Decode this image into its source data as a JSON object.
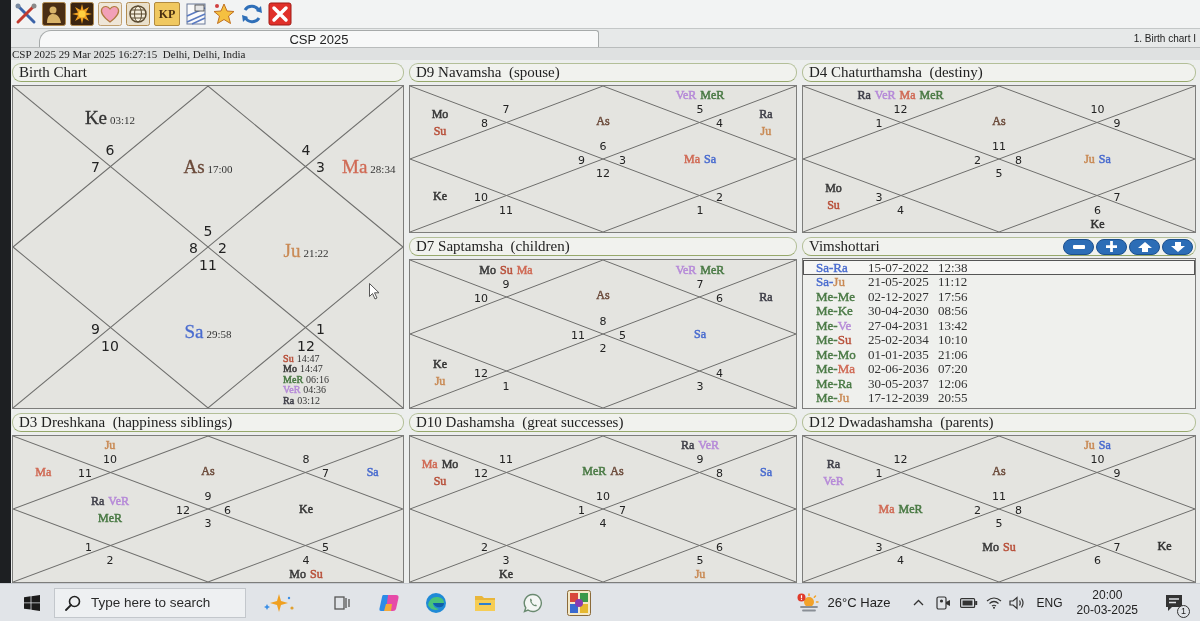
{
  "toolbar": [
    {
      "kind": "tools"
    },
    {
      "kind": "portrait"
    },
    {
      "kind": "sun"
    },
    {
      "kind": "heart"
    },
    {
      "kind": "globe"
    },
    {
      "kind": "text",
      "label": "KP"
    },
    {
      "kind": "document"
    },
    {
      "kind": "star"
    },
    {
      "kind": "refresh"
    },
    {
      "kind": "close"
    }
  ],
  "tabs": [
    {
      "label": "CSP 2025",
      "selected": true
    }
  ],
  "view_label": "1. Birth chart I",
  "info": "CSP 2025 29 Mar 2025 16:27:15  Delhi, Delhi, India",
  "panels": [
    {
      "kind": "rasi",
      "title": "Birth Chart",
      "mouse_pointer": true,
      "signs": [
        "6",
        "4",
        "7",
        "3",
        "5",
        "8",
        "2",
        "11",
        "9",
        "1",
        "10",
        "12"
      ],
      "placements": [
        {
          "kind": "top-left",
          "planets": [
            {
              "name": "Ke",
              "degree": "03:12",
              "color": "#333333"
            }
          ]
        },
        {
          "kind": "top",
          "planets": [
            {
              "name": "As",
              "degree": "17:00",
              "color": "#6b4a3a"
            }
          ]
        },
        {
          "kind": "right-upper",
          "planets": [
            {
              "name": "Ma",
              "degree": "28:34",
              "color": "#d06a55"
            }
          ]
        },
        {
          "kind": "right",
          "planets": [
            {
              "name": "Ju",
              "degree": "21:22",
              "color": "#c98a55"
            }
          ]
        },
        {
          "kind": "bottom",
          "planets": [
            {
              "name": "Sa",
              "degree": "29:58",
              "color": "#4a6ccf"
            }
          ]
        },
        {
          "kind": "bottom-right",
          "planets": [
            {
              "name": "Su",
              "degree": "14:47",
              "color": "#b8503a"
            },
            {
              "name": "Mo",
              "degree": "14:47",
              "color": "#3a3a3a"
            },
            {
              "name": "MeR",
              "degree": "06:16",
              "color": "#4a7a45"
            },
            {
              "name": "VeR",
              "degree": "04:36",
              "color": "#b68ad8"
            },
            {
              "name": "Ra",
              "degree": "03:12",
              "color": "#3e3e48"
            }
          ]
        }
      ]
    },
    {
      "kind": "varga",
      "title": "D9 Navamsha  (spouse)",
      "signs": [
        "7",
        "5",
        "8",
        "4",
        "6",
        "9",
        "3",
        "12",
        "10",
        "2",
        "11",
        "1"
      ],
      "placements": [
        {
          "kind": "top-right",
          "planets": [
            {
              "name": "VeR",
              "color": "#b68ad8"
            },
            {
              "name": "MeR",
              "color": "#4a7a45"
            }
          ]
        },
        {
          "kind": "left-upper",
          "planets": [
            {
              "name": "Mo",
              "color": "#3a3a3a"
            },
            {
              "name": "Su",
              "color": "#b8503a"
            }
          ]
        },
        {
          "kind": "top",
          "planets": [
            {
              "name": "As",
              "color": "#6b4a3a"
            }
          ]
        },
        {
          "kind": "right-upper",
          "planets": [
            {
              "name": "Ra",
              "color": "#3e3e48"
            },
            {
              "name": "Ju",
              "color": "#c98a55"
            }
          ]
        },
        {
          "kind": "right",
          "planets": [
            {
              "name": "Ma",
              "color": "#d06a55"
            },
            {
              "name": "Sa",
              "color": "#4a6ccf"
            }
          ]
        },
        {
          "kind": "left-lower",
          "planets": [
            {
              "name": "Ke",
              "color": "#333333"
            }
          ]
        }
      ]
    },
    {
      "kind": "varga",
      "title": "D4 Chaturthamsha  (destiny)",
      "signs": [
        "12",
        "10",
        "1",
        "9",
        "11",
        "2",
        "8",
        "5",
        "3",
        "7",
        "4",
        "6"
      ],
      "placements": [
        {
          "kind": "top-left",
          "planets": [
            {
              "name": "Ra",
              "color": "#3e3e48"
            },
            {
              "name": "VeR",
              "color": "#b68ad8"
            },
            {
              "name": "Ma",
              "color": "#d06a55"
            },
            {
              "name": "MeR",
              "color": "#4a7a45"
            }
          ]
        },
        {
          "kind": "top",
          "planets": [
            {
              "name": "As",
              "color": "#6b4a3a"
            }
          ]
        },
        {
          "kind": "right",
          "planets": [
            {
              "name": "Ju",
              "color": "#c98a55"
            },
            {
              "name": "Sa",
              "color": "#4a6ccf"
            }
          ]
        },
        {
          "kind": "left-lower",
          "planets": [
            {
              "name": "Mo",
              "color": "#3a3a3a"
            },
            {
              "name": "Su",
              "color": "#b8503a"
            }
          ]
        },
        {
          "kind": "bottom-right",
          "planets": [
            {
              "name": "Ke",
              "color": "#333333"
            }
          ]
        }
      ]
    },
    {
      "kind": "varga",
      "title": "D7 Saptamsha  (children)",
      "signs": [
        "9",
        "7",
        "10",
        "6",
        "8",
        "11",
        "5",
        "2",
        "12",
        "4",
        "1",
        "3"
      ],
      "placements": [
        {
          "kind": "top-left",
          "planets": [
            {
              "name": "Mo",
              "color": "#3a3a3a"
            },
            {
              "name": "Su",
              "color": "#b8503a"
            },
            {
              "name": "Ma",
              "color": "#d06a55"
            }
          ]
        },
        {
          "kind": "top-right",
          "planets": [
            {
              "name": "VeR",
              "color": "#b68ad8"
            },
            {
              "name": "MeR",
              "color": "#4a7a45"
            }
          ]
        },
        {
          "kind": "top",
          "planets": [
            {
              "name": "As",
              "color": "#6b4a3a"
            }
          ]
        },
        {
          "kind": "right-upper",
          "planets": [
            {
              "name": "Ra",
              "color": "#3e3e48"
            }
          ]
        },
        {
          "kind": "right",
          "planets": [
            {
              "name": "Sa",
              "color": "#4a6ccf"
            }
          ]
        },
        {
          "kind": "left-lower",
          "planets": [
            {
              "name": "Ke",
              "color": "#333333"
            },
            {
              "name": "Ju",
              "color": "#c98a55"
            }
          ]
        }
      ]
    },
    {
      "kind": "dasha",
      "title": "Vimshottari",
      "buttons": [
        {
          "kind": "minus"
        },
        {
          "kind": "plus"
        },
        {
          "kind": "up"
        },
        {
          "kind": "down"
        }
      ],
      "rows": [
        {
          "selected": true,
          "period": [
            {
              "text": "Sa-",
              "color": "#4a6ccf"
            },
            {
              "text": "Ra",
              "color": "#4a6ccf"
            }
          ],
          "date": "15-07-2022",
          "time": "12:38"
        },
        {
          "selected": false,
          "period": [
            {
              "text": "Sa-",
              "color": "#4a6ccf"
            },
            {
              "text": "Ju",
              "color": "#c98a55"
            }
          ],
          "date": "21-05-2025",
          "time": "11:12"
        },
        {
          "selected": false,
          "period": [
            {
              "text": "Me-",
              "color": "#4a7a45"
            },
            {
              "text": "Me",
              "color": "#4a7a45"
            }
          ],
          "date": "02-12-2027",
          "time": "17:56"
        },
        {
          "selected": false,
          "period": [
            {
              "text": "Me-",
              "color": "#4a7a45"
            },
            {
              "text": "Ke",
              "color": "#4a7a45"
            }
          ],
          "date": "30-04-2030",
          "time": "08:56"
        },
        {
          "selected": false,
          "period": [
            {
              "text": "Me-",
              "color": "#4a7a45"
            },
            {
              "text": "Ve",
              "color": "#b68ad8"
            }
          ],
          "date": "27-04-2031",
          "time": "13:42"
        },
        {
          "selected": false,
          "period": [
            {
              "text": "Me-",
              "color": "#4a7a45"
            },
            {
              "text": "Su",
              "color": "#b8503a"
            }
          ],
          "date": "25-02-2034",
          "time": "10:10"
        },
        {
          "selected": false,
          "period": [
            {
              "text": "Me-",
              "color": "#4a7a45"
            },
            {
              "text": "Mo",
              "color": "#4a7a45"
            }
          ],
          "date": "01-01-2035",
          "time": "21:06"
        },
        {
          "selected": false,
          "period": [
            {
              "text": "Me-",
              "color": "#4a7a45"
            },
            {
              "text": "Ma",
              "color": "#d06a55"
            }
          ],
          "date": "02-06-2036",
          "time": "07:20"
        },
        {
          "selected": false,
          "period": [
            {
              "text": "Me-",
              "color": "#4a7a45"
            },
            {
              "text": "Ra",
              "color": "#4a7a45"
            }
          ],
          "date": "30-05-2037",
          "time": "12:06"
        },
        {
          "selected": false,
          "period": [
            {
              "text": "Me-",
              "color": "#4a7a45"
            },
            {
              "text": "Ju",
              "color": "#c98a55"
            }
          ],
          "date": "17-12-2039",
          "time": "20:55"
        }
      ]
    },
    {
      "kind": "varga",
      "title": "D3 Dreshkana  (happiness siblings)",
      "signs": [
        "10",
        "8",
        "11",
        "7",
        "9",
        "12",
        "6",
        "3",
        "1",
        "5",
        "2",
        "4"
      ],
      "placements": [
        {
          "kind": "top-left",
          "planets": [
            {
              "name": "Ju",
              "color": "#c98a55"
            }
          ]
        },
        {
          "kind": "left-upper",
          "planets": [
            {
              "name": "Ma",
              "color": "#d06a55"
            }
          ]
        },
        {
          "kind": "top",
          "planets": [
            {
              "name": "As",
              "color": "#6b4a3a"
            }
          ]
        },
        {
          "kind": "right-upper",
          "planets": [
            {
              "name": "Sa",
              "color": "#4a6ccf"
            }
          ]
        },
        {
          "kind": "left",
          "planets": [
            {
              "name": "Ra",
              "color": "#3e3e48"
            },
            {
              "name": "VeR",
              "color": "#b68ad8"
            },
            {
              "name": "MeR",
              "color": "#4a7a45"
            }
          ]
        },
        {
          "kind": "right",
          "planets": [
            {
              "name": "Ke",
              "color": "#333333"
            }
          ]
        },
        {
          "kind": "bottom-right",
          "planets": [
            {
              "name": "Mo",
              "color": "#3a3a3a"
            },
            {
              "name": "Su",
              "color": "#b8503a"
            }
          ]
        }
      ]
    },
    {
      "kind": "varga",
      "title": "D10 Dashamsha  (great successes)",
      "signs": [
        "11",
        "9",
        "12",
        "8",
        "10",
        "1",
        "7",
        "4",
        "2",
        "6",
        "3",
        "5"
      ],
      "placements": [
        {
          "kind": "top-right",
          "planets": [
            {
              "name": "Ra",
              "color": "#3e3e48"
            },
            {
              "name": "VeR",
              "color": "#b68ad8"
            }
          ]
        },
        {
          "kind": "left-upper",
          "planets": [
            {
              "name": "Ma",
              "color": "#d06a55"
            },
            {
              "name": "Mo",
              "color": "#3a3a3a"
            },
            {
              "name": "Su",
              "color": "#b8503a"
            }
          ]
        },
        {
          "kind": "top",
          "planets": [
            {
              "name": "MeR",
              "color": "#4a7a45"
            },
            {
              "name": "As",
              "color": "#6b4a3a"
            }
          ]
        },
        {
          "kind": "right-upper",
          "planets": [
            {
              "name": "Sa",
              "color": "#4a6ccf"
            }
          ]
        },
        {
          "kind": "bottom-left",
          "planets": [
            {
              "name": "Ke",
              "color": "#333333"
            }
          ]
        },
        {
          "kind": "bottom-right",
          "planets": [
            {
              "name": "Ju",
              "color": "#c98a55"
            }
          ]
        }
      ]
    },
    {
      "kind": "varga",
      "title": "D12 Dwadashamsha  (parents)",
      "signs": [
        "12",
        "10",
        "1",
        "9",
        "11",
        "2",
        "8",
        "5",
        "3",
        "7",
        "4",
        "6"
      ],
      "placements": [
        {
          "kind": "top-right",
          "planets": [
            {
              "name": "Ju",
              "color": "#c98a55"
            },
            {
              "name": "Sa",
              "color": "#4a6ccf"
            }
          ]
        },
        {
          "kind": "left-upper",
          "planets": [
            {
              "name": "Ra",
              "color": "#3e3e48"
            },
            {
              "name": "VeR",
              "color": "#b68ad8"
            }
          ]
        },
        {
          "kind": "top",
          "planets": [
            {
              "name": "As",
              "color": "#6b4a3a"
            }
          ]
        },
        {
          "kind": "left",
          "planets": [
            {
              "name": "Ma",
              "color": "#d06a55"
            },
            {
              "name": "MeR",
              "color": "#4a7a45"
            }
          ]
        },
        {
          "kind": "bottom",
          "planets": [
            {
              "name": "Mo",
              "color": "#3a3a3a"
            },
            {
              "name": "Su",
              "color": "#b8503a"
            }
          ]
        },
        {
          "kind": "right-lower",
          "planets": [
            {
              "name": "Ke",
              "color": "#333333"
            }
          ]
        }
      ]
    }
  ],
  "taskbar": {
    "search": {
      "placeholder": "Type here to search"
    },
    "weather": "26°C Haze",
    "language": "ENG",
    "time": "20:00",
    "date": "20-03-2025",
    "notification_count": "1"
  }
}
